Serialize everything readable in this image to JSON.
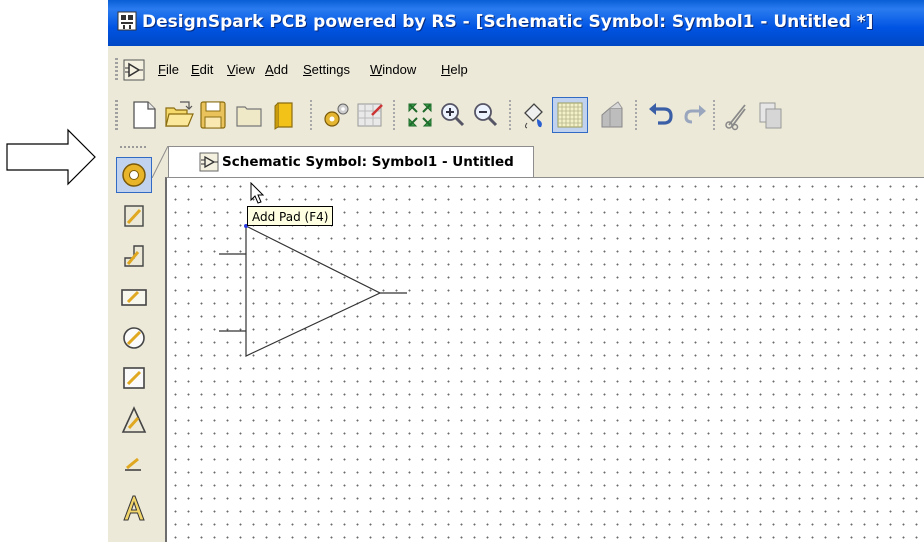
{
  "window": {
    "title": "DesignSpark PCB powered by RS - [Schematic Symbol: Symbol1 - Untitled *]"
  },
  "menu": {
    "items": [
      {
        "label": "File",
        "mnemonic": "F"
      },
      {
        "label": "Edit",
        "mnemonic": "E"
      },
      {
        "label": "View",
        "mnemonic": "V"
      },
      {
        "label": "Add",
        "mnemonic": "A"
      },
      {
        "label": "Settings",
        "mnemonic": "S"
      },
      {
        "label": "Window",
        "mnemonic": "W"
      },
      {
        "label": "Help",
        "mnemonic": "H"
      }
    ]
  },
  "toolbar": {
    "icons": [
      "new-file-icon",
      "open-folder-icon",
      "save-icon",
      "close-icon",
      "book-icon",
      "gears-icon",
      "grid-settings-icon",
      "zoom-fit-icon",
      "zoom-in-icon",
      "zoom-out-icon",
      "fill-icon",
      "grid-toggle-icon",
      "print-icon",
      "undo-icon",
      "redo-icon",
      "cut-icon",
      "copy-icon"
    ]
  },
  "palette": {
    "tools": [
      "add-pad-icon",
      "line-icon",
      "path-icon",
      "rectangle-icon",
      "circle-icon",
      "square-icon",
      "triangle-icon",
      "arc-icon",
      "text-icon"
    ],
    "active_tool": "add-pad-icon"
  },
  "document_tab": {
    "label": "Schematic Symbol: Symbol1 - Untitled"
  },
  "tooltip": {
    "text": "Add Pad (F4)"
  },
  "colors": {
    "title_bar": "#0054e3",
    "chrome": "#ece9d8",
    "tooltip_bg": "#ffffe1",
    "active_tool": "#c1d2ee"
  }
}
